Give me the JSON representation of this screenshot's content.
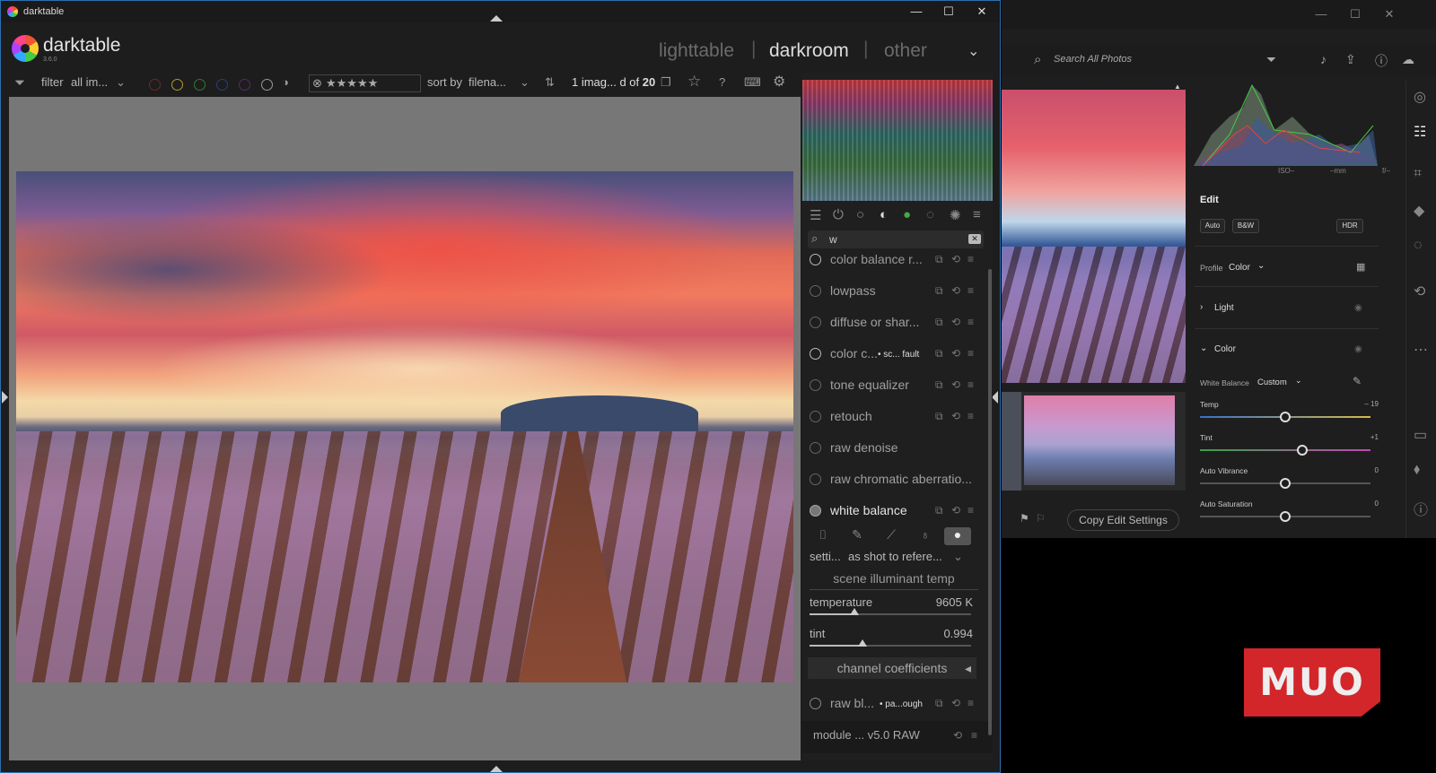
{
  "darktable": {
    "window_title": "darktable",
    "window_controls": [
      "—",
      "☐",
      "✕"
    ],
    "app_name": "darktable",
    "version": "3.6.0",
    "views": {
      "lighttable": "lighttable",
      "darkroom": "darkroom",
      "other": "other"
    },
    "toolbar": {
      "filter_label": "filter",
      "filter_value": "all im...",
      "sort_label": "sort by",
      "sort_value": "filena...",
      "count_prefix": "1 imag... d of ",
      "count_total": "20",
      "stars": "★★★★★"
    },
    "module_search": "w",
    "modules": [
      {
        "label": "color balance r...",
        "active": true
      },
      {
        "label": "lowpass",
        "active": false
      },
      {
        "label": "diffuse or shar...",
        "active": false
      },
      {
        "label": "color c...",
        "sub": "• sc... fault",
        "active": true
      },
      {
        "label": "tone equalizer",
        "active": false
      },
      {
        "label": "retouch",
        "active": false
      },
      {
        "label": "raw denoise",
        "active": false
      },
      {
        "label": "raw chromatic aberratio...",
        "active": false
      },
      {
        "label": "white balance",
        "active": true
      }
    ],
    "white_balance": {
      "settings_label": "setti...",
      "settings_value": "as shot to refere...",
      "section_header": "scene illuminant temp",
      "temperature_label": "temperature",
      "temperature_value": "9605 K",
      "temperature_fraction": 0.28,
      "tint_label": "tint",
      "tint_value": "0.994",
      "tint_fraction": 0.33,
      "channel_coefficients": "channel coefficients"
    },
    "raw_black": {
      "label": "raw bl...",
      "sub": "• pa...ough"
    },
    "footer": "module ... v5.0 RAW"
  },
  "lightroom": {
    "window_controls": [
      "—",
      "☐",
      "✕"
    ],
    "search_placeholder": "Search All Photos",
    "copy_edit": "Copy Edit Settings",
    "exif": {
      "iso": "ISO–",
      "mm": "–mm",
      "f": "f/–",
      "s": "–s"
    },
    "edit": {
      "title": "Edit",
      "auto": "Auto",
      "bw": "B&W",
      "hdr": "HDR",
      "profile_label": "Profile",
      "profile_value": "Color",
      "light": "Light",
      "color": "Color",
      "wb_label": "White Balance",
      "wb_value": "Custom",
      "sliders": [
        {
          "label": "Temp",
          "value": "– 19",
          "fraction": 0.5
        },
        {
          "label": "Tint",
          "value": "+1",
          "fraction": 0.6
        },
        {
          "label": "Auto Vibrance",
          "value": "0",
          "fraction": 0.5
        },
        {
          "label": "Auto Saturation",
          "value": "0",
          "fraction": 0.5
        }
      ]
    }
  },
  "watermark": "MUO"
}
